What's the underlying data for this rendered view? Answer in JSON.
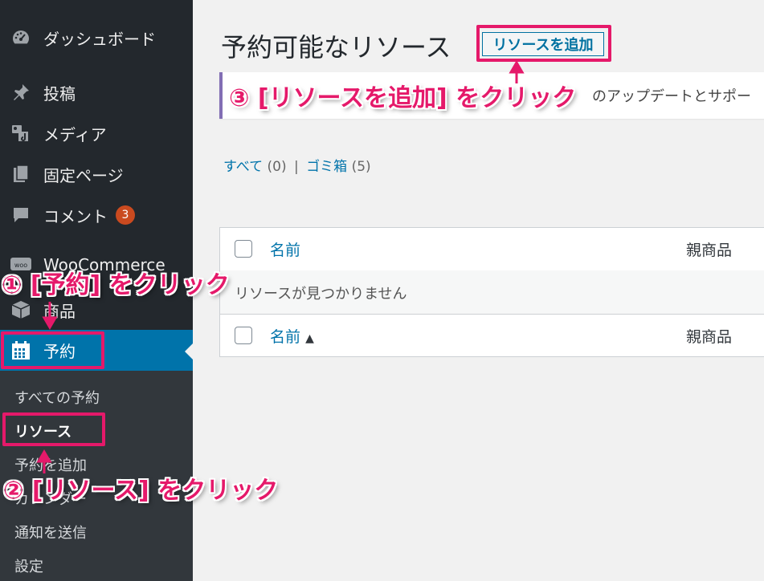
{
  "sidebar": {
    "items": [
      {
        "label": "ダッシュボード",
        "icon": "dashboard-icon"
      },
      {
        "label": "投稿",
        "icon": "pushpin-icon"
      },
      {
        "label": "メディア",
        "icon": "media-icon"
      },
      {
        "label": "固定ページ",
        "icon": "pages-icon"
      },
      {
        "label": "コメント",
        "icon": "comment-icon",
        "badge": "3"
      },
      {
        "label": "WooCommerce",
        "icon": "woo-icon"
      },
      {
        "label": "商品",
        "icon": "box-icon"
      },
      {
        "label": "予約",
        "icon": "calendar-icon",
        "active": true
      }
    ],
    "submenu": [
      "すべての予約",
      "リソース",
      "予約を追加",
      "カレンダー",
      "通知を送信",
      "設定"
    ]
  },
  "main": {
    "title": "予約可能なリソース",
    "add_button": "リソースを追加",
    "notice_text": "のアップデートとサポー",
    "views": {
      "all": "すべて",
      "all_count": "(0)",
      "separator": "|",
      "trash": "ゴミ箱",
      "trash_count": "(5)"
    },
    "table": {
      "col_name": "名前",
      "col_parent": "親商品",
      "empty_message": "リソースが見つかりません",
      "sort_indicator": "▲"
    }
  },
  "annotations": [
    "① [予約] をクリック",
    "② [リソース] をクリック",
    "③ [リソースを追加] をクリック"
  ],
  "colors": {
    "highlight": "#e5196a",
    "admin_bar": "#23282d",
    "active": "#0073aa",
    "badge": "#ca4a1f"
  }
}
